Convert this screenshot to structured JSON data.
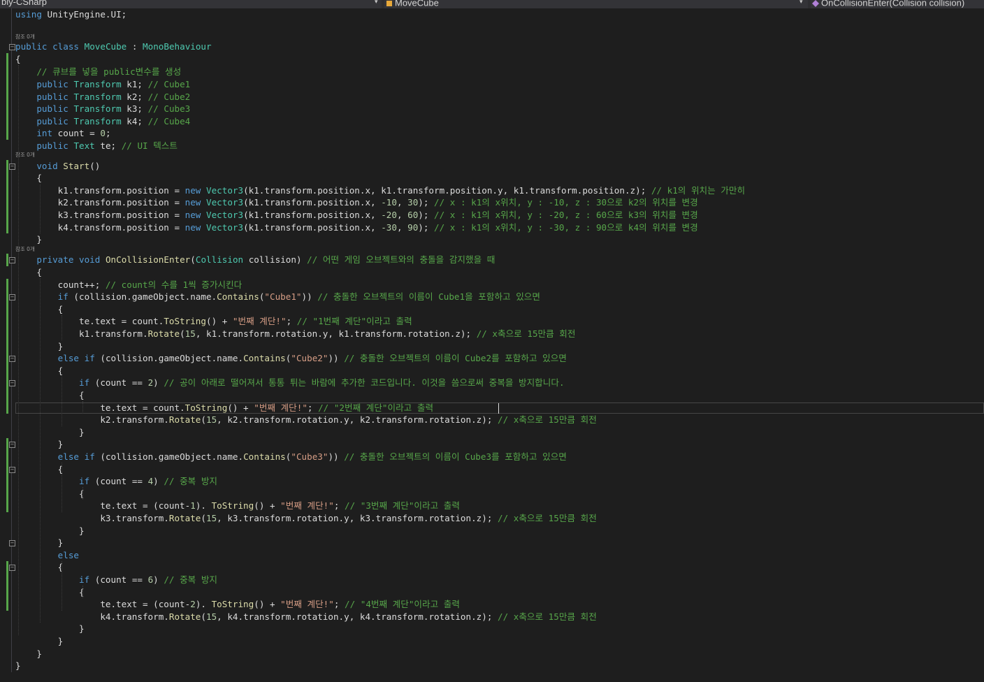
{
  "navbar": {
    "project": "bly-CSharp",
    "class": "MoveCube",
    "member": "OnCollisionEnter(Collision collision)"
  },
  "code_lens": {
    "references_0": "참조 0개"
  },
  "colors": {
    "keyword": "#569cd6",
    "type": "#4ec9b0",
    "method": "#dcdcaa",
    "string": "#d69d85",
    "number": "#b5cea8",
    "comment": "#57a64a",
    "plain": "#dcdcdc",
    "background": "#1e1e1e"
  },
  "code_lines": [
    [
      [
        "kw",
        "using"
      ],
      [
        "pl",
        " UnityEngine.UI;"
      ]
    ],
    [],
    [
      [
        "kw",
        "public"
      ],
      [
        "pl",
        " "
      ],
      [
        "kw",
        "class"
      ],
      [
        "pl",
        " "
      ],
      [
        "ty",
        "MoveCube"
      ],
      [
        "pl",
        " : "
      ],
      [
        "ty",
        "MonoBehaviour"
      ]
    ],
    [
      [
        "pl",
        "{"
      ]
    ],
    [
      [
        "pl",
        "    "
      ],
      [
        "cm",
        "// 큐브를 넣을 public변수를 생성"
      ]
    ],
    [
      [
        "pl",
        "    "
      ],
      [
        "kw",
        "public"
      ],
      [
        "pl",
        " "
      ],
      [
        "ty",
        "Transform"
      ],
      [
        "pl",
        " k1; "
      ],
      [
        "cm",
        "// Cube1"
      ]
    ],
    [
      [
        "pl",
        "    "
      ],
      [
        "kw",
        "public"
      ],
      [
        "pl",
        " "
      ],
      [
        "ty",
        "Transform"
      ],
      [
        "pl",
        " k2; "
      ],
      [
        "cm",
        "// Cube2"
      ]
    ],
    [
      [
        "pl",
        "    "
      ],
      [
        "kw",
        "public"
      ],
      [
        "pl",
        " "
      ],
      [
        "ty",
        "Transform"
      ],
      [
        "pl",
        " k3; "
      ],
      [
        "cm",
        "// Cube3"
      ]
    ],
    [
      [
        "pl",
        "    "
      ],
      [
        "kw",
        "public"
      ],
      [
        "pl",
        " "
      ],
      [
        "ty",
        "Transform"
      ],
      [
        "pl",
        " k4; "
      ],
      [
        "cm",
        "// Cube4"
      ]
    ],
    [
      [
        "pl",
        "    "
      ],
      [
        "kw",
        "int"
      ],
      [
        "pl",
        " count = "
      ],
      [
        "num",
        "0"
      ],
      [
        "pl",
        ";"
      ]
    ],
    [
      [
        "pl",
        "    "
      ],
      [
        "kw",
        "public"
      ],
      [
        "pl",
        " "
      ],
      [
        "ty",
        "Text"
      ],
      [
        "pl",
        " te; "
      ],
      [
        "cm",
        "// UI 텍스트"
      ]
    ],
    [
      [
        "pl",
        "    "
      ],
      [
        "kw",
        "void"
      ],
      [
        "pl",
        " "
      ],
      [
        "fn",
        "Start"
      ],
      [
        "pl",
        "()"
      ]
    ],
    [
      [
        "pl",
        "    {"
      ]
    ],
    [
      [
        "pl",
        "        k1.transform.position = "
      ],
      [
        "kw",
        "new"
      ],
      [
        "pl",
        " "
      ],
      [
        "ty",
        "Vector3"
      ],
      [
        "pl",
        "(k1.transform.position.x, k1.transform.position.y, k1.transform.position.z); "
      ],
      [
        "cm",
        "// k1의 위치는 가만히"
      ]
    ],
    [
      [
        "pl",
        "        k2.transform.position = "
      ],
      [
        "kw",
        "new"
      ],
      [
        "pl",
        " "
      ],
      [
        "ty",
        "Vector3"
      ],
      [
        "pl",
        "(k1.transform.position.x, "
      ],
      [
        "num",
        "-10"
      ],
      [
        "pl",
        ", "
      ],
      [
        "num",
        "30"
      ],
      [
        "pl",
        "); "
      ],
      [
        "cm",
        "// x : k1의 x위치, y : -10, z : 30으로 k2의 위치를 변경"
      ]
    ],
    [
      [
        "pl",
        "        k3.transform.position = "
      ],
      [
        "kw",
        "new"
      ],
      [
        "pl",
        " "
      ],
      [
        "ty",
        "Vector3"
      ],
      [
        "pl",
        "(k1.transform.position.x, "
      ],
      [
        "num",
        "-20"
      ],
      [
        "pl",
        ", "
      ],
      [
        "num",
        "60"
      ],
      [
        "pl",
        "); "
      ],
      [
        "cm",
        "// x : k1의 x위치, y : -20, z : 60으로 k3의 위치를 변경"
      ]
    ],
    [
      [
        "pl",
        "        k4.transform.position = "
      ],
      [
        "kw",
        "new"
      ],
      [
        "pl",
        " "
      ],
      [
        "ty",
        "Vector3"
      ],
      [
        "pl",
        "(k1.transform.position.x, "
      ],
      [
        "num",
        "-30"
      ],
      [
        "pl",
        ", "
      ],
      [
        "num",
        "90"
      ],
      [
        "pl",
        "); "
      ],
      [
        "cm",
        "// x : k1의 x위치, y : -30, z : 90으로 k4의 위치를 변경"
      ]
    ],
    [
      [
        "pl",
        "    }"
      ]
    ],
    [
      [
        "pl",
        "    "
      ],
      [
        "kw",
        "private"
      ],
      [
        "pl",
        " "
      ],
      [
        "kw",
        "void"
      ],
      [
        "pl",
        " "
      ],
      [
        "fn",
        "OnCollisionEnter"
      ],
      [
        "pl",
        "("
      ],
      [
        "ty",
        "Collision"
      ],
      [
        "pl",
        " collision) "
      ],
      [
        "cm",
        "// 어떤 게임 오브젝트와의 충돌을 감지했을 때"
      ]
    ],
    [
      [
        "pl",
        "    {"
      ]
    ],
    [
      [
        "pl",
        "        count++; "
      ],
      [
        "cm",
        "// count의 수를 1씩 증가시킨다"
      ]
    ],
    [
      [
        "pl",
        "        "
      ],
      [
        "kw",
        "if"
      ],
      [
        "pl",
        " (collision.gameObject.name."
      ],
      [
        "fn",
        "Contains"
      ],
      [
        "pl",
        "("
      ],
      [
        "str",
        "\"Cube1\""
      ],
      [
        "pl",
        ")) "
      ],
      [
        "cm",
        "// 충돌한 오브젝트의 이름이 Cube1을 포함하고 있으면"
      ]
    ],
    [
      [
        "pl",
        "        {"
      ]
    ],
    [
      [
        "pl",
        "            te.text = count."
      ],
      [
        "fn",
        "ToString"
      ],
      [
        "pl",
        "() + "
      ],
      [
        "str",
        "\"번째 계단!\""
      ],
      [
        "pl",
        "; "
      ],
      [
        "cm",
        "// \"1번째 계단\"이라고 출력"
      ]
    ],
    [
      [
        "pl",
        "            k1.transform."
      ],
      [
        "fn",
        "Rotate"
      ],
      [
        "pl",
        "("
      ],
      [
        "num",
        "15"
      ],
      [
        "pl",
        ", k1.transform.rotation.y, k1.transform.rotation.z); "
      ],
      [
        "cm",
        "// x축으로 15만큼 회전"
      ]
    ],
    [
      [
        "pl",
        "        }"
      ]
    ],
    [
      [
        "pl",
        "        "
      ],
      [
        "kw",
        "else"
      ],
      [
        "pl",
        " "
      ],
      [
        "kw",
        "if"
      ],
      [
        "pl",
        " (collision.gameObject.name."
      ],
      [
        "fn",
        "Contains"
      ],
      [
        "pl",
        "("
      ],
      [
        "str",
        "\"Cube2\""
      ],
      [
        "pl",
        ")) "
      ],
      [
        "cm",
        "// 충돌한 오브젝트의 이름이 Cube2를 포함하고 있으면"
      ]
    ],
    [
      [
        "pl",
        "        {"
      ]
    ],
    [
      [
        "pl",
        "            "
      ],
      [
        "kw",
        "if"
      ],
      [
        "pl",
        " (count == "
      ],
      [
        "num",
        "2"
      ],
      [
        "pl",
        ") "
      ],
      [
        "cm",
        "// 공이 아래로 떨어져서 통통 튀는 바람에 추가한 코드입니다. 이것을 씀으로써 중복을 방지합니다."
      ]
    ],
    [
      [
        "pl",
        "            {"
      ]
    ],
    [
      [
        "pl",
        "                te.text = count."
      ],
      [
        "fn",
        "ToString"
      ],
      [
        "pl",
        "() + "
      ],
      [
        "str",
        "\"번째 계단!\""
      ],
      [
        "pl",
        "; "
      ],
      [
        "cm",
        "// \"2번째 계단\"이라고 출력"
      ]
    ],
    [
      [
        "pl",
        "                k2.transform."
      ],
      [
        "fn",
        "Rotate"
      ],
      [
        "pl",
        "("
      ],
      [
        "num",
        "15"
      ],
      [
        "pl",
        ", k2.transform.rotation.y, k2.transform.rotation.z); "
      ],
      [
        "cm",
        "// x축으로 15만큼 회전"
      ]
    ],
    [
      [
        "pl",
        "            }"
      ]
    ],
    [
      [
        "pl",
        "        }"
      ]
    ],
    [
      [
        "pl",
        "        "
      ],
      [
        "kw",
        "else"
      ],
      [
        "pl",
        " "
      ],
      [
        "kw",
        "if"
      ],
      [
        "pl",
        " (collision.gameObject.name."
      ],
      [
        "fn",
        "Contains"
      ],
      [
        "pl",
        "("
      ],
      [
        "str",
        "\"Cube3\""
      ],
      [
        "pl",
        ")) "
      ],
      [
        "cm",
        "// 충돌한 오브젝트의 이름이 Cube3를 포함하고 있으면"
      ]
    ],
    [
      [
        "pl",
        "        {"
      ]
    ],
    [
      [
        "pl",
        "            "
      ],
      [
        "kw",
        "if"
      ],
      [
        "pl",
        " (count == "
      ],
      [
        "num",
        "4"
      ],
      [
        "pl",
        ") "
      ],
      [
        "cm",
        "// 중복 방지"
      ]
    ],
    [
      [
        "pl",
        "            {"
      ]
    ],
    [
      [
        "pl",
        "                te.text = (count-"
      ],
      [
        "num",
        "1"
      ],
      [
        "pl",
        "). "
      ],
      [
        "fn",
        "ToString"
      ],
      [
        "pl",
        "() + "
      ],
      [
        "str",
        "\"번째 계단!\""
      ],
      [
        "pl",
        "; "
      ],
      [
        "cm",
        "// \"3번째 계단\"이라고 출력"
      ]
    ],
    [
      [
        "pl",
        "                k3.transform."
      ],
      [
        "fn",
        "Rotate"
      ],
      [
        "pl",
        "("
      ],
      [
        "num",
        "15"
      ],
      [
        "pl",
        ", k3.transform.rotation.y, k3.transform.rotation.z); "
      ],
      [
        "cm",
        "// x축으로 15만큼 회전"
      ]
    ],
    [
      [
        "pl",
        "            }"
      ]
    ],
    [
      [
        "pl",
        "        }"
      ]
    ],
    [
      [
        "pl",
        "        "
      ],
      [
        "kw",
        "else"
      ]
    ],
    [
      [
        "pl",
        "        {"
      ]
    ],
    [
      [
        "pl",
        "            "
      ],
      [
        "kw",
        "if"
      ],
      [
        "pl",
        " (count == "
      ],
      [
        "num",
        "6"
      ],
      [
        "pl",
        ") "
      ],
      [
        "cm",
        "// 중복 방지"
      ]
    ],
    [
      [
        "pl",
        "            {"
      ]
    ],
    [
      [
        "pl",
        "                te.text = (count-"
      ],
      [
        "num",
        "2"
      ],
      [
        "pl",
        "). "
      ],
      [
        "fn",
        "ToString"
      ],
      [
        "pl",
        "() + "
      ],
      [
        "str",
        "\"번째 계단!\""
      ],
      [
        "pl",
        "; "
      ],
      [
        "cm",
        "// \"4번째 계단\"이라고 출력"
      ]
    ],
    [
      [
        "pl",
        "                k4.transform."
      ],
      [
        "fn",
        "Rotate"
      ],
      [
        "pl",
        "("
      ],
      [
        "num",
        "15"
      ],
      [
        "pl",
        ", k4.transform.rotation.y, k4.transform.rotation.z); "
      ],
      [
        "cm",
        "// x축으로 15만큼 회전"
      ]
    ],
    [
      [
        "pl",
        "            }"
      ]
    ],
    [
      [
        "pl",
        "        }"
      ]
    ],
    [
      [
        "pl",
        "    }"
      ]
    ],
    [
      [
        "pl",
        "}"
      ]
    ]
  ]
}
